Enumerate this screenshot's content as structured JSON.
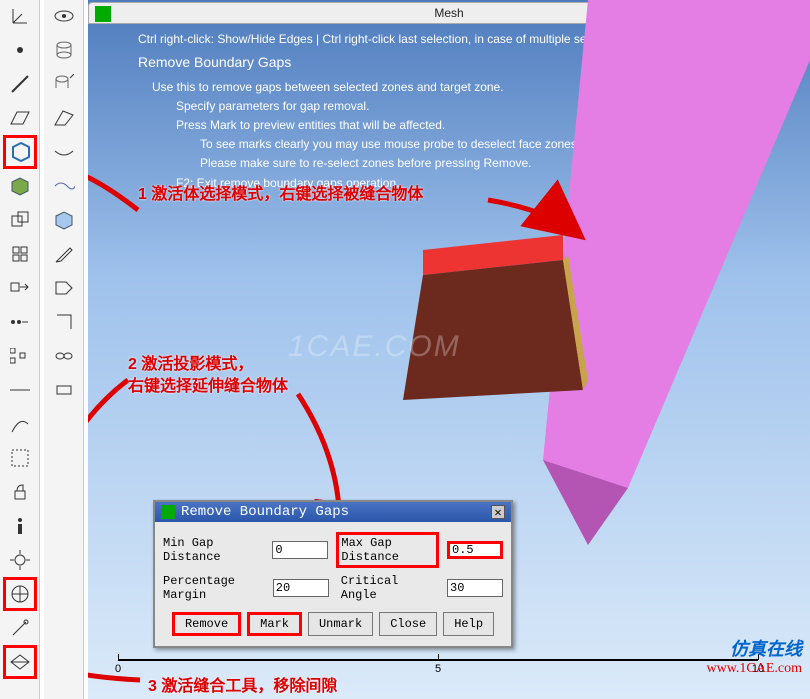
{
  "window": {
    "title": "Mesh"
  },
  "help": {
    "line0": "Ctrl right-click: Show/Hide Edges | Ctrl right-click last selection, in case of multiple selections | Ctrl",
    "heading": "Remove Boundary Gaps",
    "line1": "Use this to remove gaps between selected zones and target zone.",
    "line2": "Specify parameters for gap removal.",
    "line3": "Press Mark to preview entities that will be affected.",
    "line4": "To see marks clearly you may use mouse probe to deselect face zones.",
    "line5": "Please make sure to re-select zones before pressing Remove.",
    "line6": "F2: Exit remove boundary gaps operation."
  },
  "annotations": {
    "a1": "1 激活体选择模式，右键选择被缝合物体",
    "a2a": "2 激活投影模式，",
    "a2b": "右键选择延伸缝合物体",
    "a3": "3 激活缝合工具，移除间隙"
  },
  "dialog": {
    "title": "Remove Boundary Gaps",
    "min_gap_label": "Min Gap Distance",
    "min_gap_value": "0",
    "max_gap_label": "Max Gap Distance",
    "max_gap_value": "0.5",
    "pct_margin_label": "Percentage Margin",
    "pct_margin_value": "20",
    "crit_angle_label": "Critical Angle",
    "crit_angle_value": "30",
    "buttons": {
      "remove": "Remove",
      "mark": "Mark",
      "unmark": "Unmark",
      "close": "Close",
      "help": "Help"
    }
  },
  "scale": {
    "t0": "0",
    "t1": "5",
    "t2": "10"
  },
  "brand": {
    "cn": "仿真在线",
    "url": "www.1CAE.com"
  },
  "watermark": "1CAE.COM"
}
